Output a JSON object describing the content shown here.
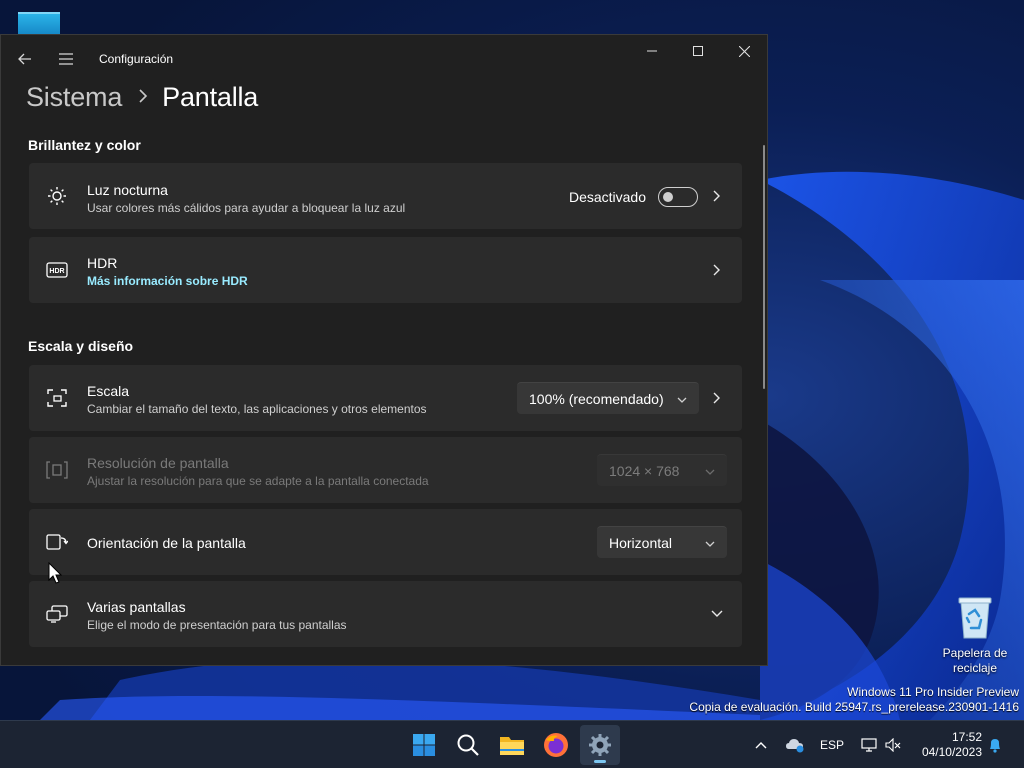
{
  "window": {
    "app_title": "Configuración",
    "breadcrumb_parent": "Sistema",
    "breadcrumb_current": "Pantalla"
  },
  "sections": {
    "brightness": "Brillantez y color",
    "scale": "Escala y diseño"
  },
  "night_light": {
    "title": "Luz nocturna",
    "subtitle": "Usar colores más cálidos para ayudar a bloquear la luz azul",
    "state_label": "Desactivado",
    "enabled": false
  },
  "hdr": {
    "title": "HDR",
    "link": "Más información sobre HDR"
  },
  "scale": {
    "title": "Escala",
    "subtitle": "Cambiar el tamaño del texto, las aplicaciones y otros elementos",
    "value": "100% (recomendado)"
  },
  "resolution": {
    "title": "Resolución de pantalla",
    "subtitle": "Ajustar la resolución para que se adapte a la pantalla conectada",
    "value": "1024 × 768",
    "disabled": true
  },
  "orientation": {
    "title": "Orientación de la pantalla",
    "value": "Horizontal"
  },
  "multiple_displays": {
    "title": "Varias pantallas",
    "subtitle": "Elige el modo de presentación para tus pantallas"
  },
  "desktop": {
    "recycle_bin_label": "Papelera de reciclaje",
    "watermark_line1": "Windows 11 Pro Insider Preview",
    "watermark_line2": "Copia de evaluación. Build 25947.rs_prerelease.230901-1416"
  },
  "taskbar": {
    "apps": [
      "start-icon",
      "search-icon",
      "file-explorer-icon",
      "firefox-icon",
      "settings-icon"
    ],
    "active_app": "settings",
    "language": "ESP",
    "time": "17:52",
    "date": "04/10/2023"
  },
  "colors": {
    "window_bg": "#202020",
    "card_bg": "#2b2b2b",
    "link": "#99ebff",
    "accent": "#7cc6f0"
  }
}
